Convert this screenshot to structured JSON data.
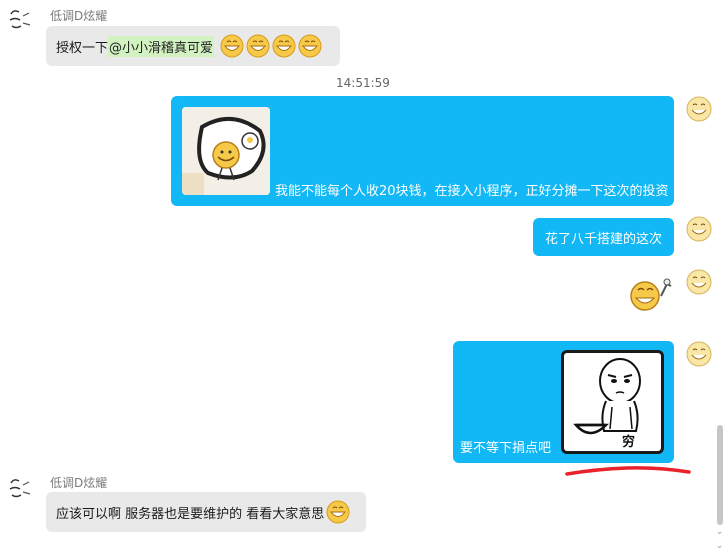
{
  "messages": {
    "m1": {
      "sender": "低调D炫耀",
      "text_prefix": "授权一下",
      "mention": "@小小滑稽真可爱",
      "emoji_icons": [
        "grin-emoji-icon",
        "grin-emoji-icon",
        "grin-emoji-icon",
        "grin-emoji-icon"
      ]
    },
    "timestamp": "14:51:59",
    "m2": {
      "text": "我能不能每个人收20块钱，在接入小程序，正好分摊一下这次的投资"
    },
    "m3": {
      "text": "花了八千搭建的这次"
    },
    "m5": {
      "text": "要不等下捐点吧",
      "sticker_caption": "穷"
    },
    "m6": {
      "sender": "低调D炫耀",
      "text": "应该可以啊 服务器也是要维护的 看看大家意思",
      "emoji_icon": "grin-emoji-icon"
    }
  },
  "colors": {
    "self_bubble": "#12b7f5",
    "other_bubble": "#e9e9e9",
    "mention_highlight": "#d3f2c2",
    "annotation_underline": "#e8232b"
  }
}
